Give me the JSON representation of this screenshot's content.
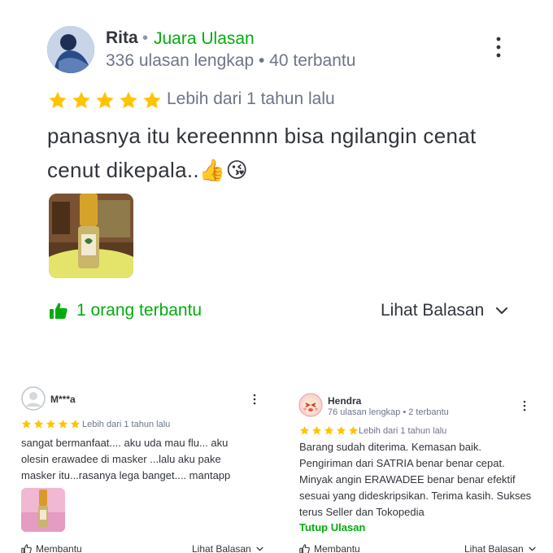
{
  "main_review": {
    "reviewer_name": "Rita",
    "badge": "Juara Ulasan",
    "reviewer_stats": "336 ulasan lengkap • 40 terbantu",
    "rating": 5,
    "date": "Lebih dari 1 tahun lalu",
    "text": "panasnya itu kereennnn bisa ngilangin cenat cenut dikepala..👍😘",
    "helpful_label": "1 orang terbantu",
    "reply_label": "Lihat Balasan",
    "icons": [
      "avatar",
      "kebab-menu-icon",
      "star-icon",
      "thumbs-up-icon",
      "chevron-down-icon"
    ]
  },
  "reviews": [
    {
      "reviewer_name": "M***a",
      "rating": 5,
      "date": "Lebih dari 1 tahun lalu",
      "text": "sangat bermanfaat.... aku uda mau flu... aku olesin erawadee di masker ...lalu aku pake masker itu...rasanya lega banget.... mantapp",
      "helpful_label": "Membantu",
      "reply_label": "Lihat Balasan"
    },
    {
      "reviewer_name": "Hendra",
      "reviewer_stats": "76 ulasan lengkap • 2 terbantu",
      "rating": 5,
      "date": "Lebih dari 1 tahun lalu",
      "text": "Barang sudah diterima. Kemasan baik. Pengiriman dari SATRIA benar benar cepat. Minyak angin ERAWADEE benar benar efektif sesuai yang dideskripsikan. Terima kasih. Sukses terus Seller dan Tokopedia",
      "collapse_label": "Tutup Ulasan",
      "helpful_label": "Membantu",
      "reply_label": "Lihat Balasan"
    }
  ],
  "colors": {
    "accent_green": "#03ac0e",
    "star_yellow": "#ffc400",
    "text_primary": "#31353b",
    "text_secondary": "#6d7588"
  }
}
